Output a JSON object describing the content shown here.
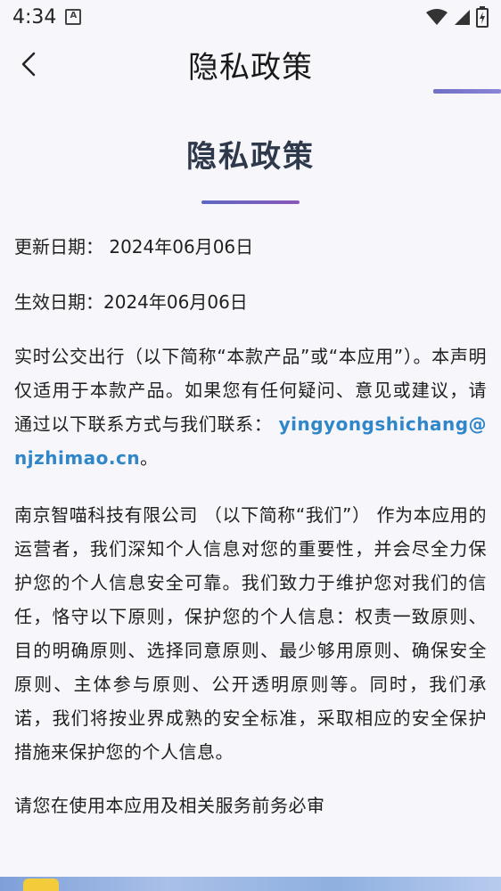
{
  "status_bar": {
    "time": "4:34",
    "notification_letter": "A",
    "icons": [
      "wifi-icon",
      "signal-icon",
      "battery-charging-icon"
    ]
  },
  "app_bar": {
    "title": "隐私政策",
    "back_icon": "chevron-left-icon",
    "accent_color": "#7a7ad0"
  },
  "content": {
    "heading": "隐私政策",
    "updated_label": "更新日期：",
    "updated_date": "2024年06月06日",
    "effective_label": "生效日期：",
    "effective_date": "2024年06月06日",
    "intro_text": "实时公交出行（以下简称“本款产品”或“本应用”）。本声明仅适用于本款产品。如果您有任何疑问、意见或建议，请通过以下联系方式与我们联系：",
    "contact_email": "yingyongshichang@njzhimao.cn",
    "email_suffix": "。",
    "company_text": "南京智喵科技有限公司 （以下简称“我们”） 作为本应用的运营者，我们深知个人信息对您的重要性，并会尽全力保护您的个人信息安全可靠。我们致力于维护您对我们的信任，恪守以下原则，保护您的个人信息：权责一致原则、目的明确原则、选择同意原则、最少够用原则、确保安全原则、主体参与原则、公开透明原则等。同时，我们承诺，我们将按业界成熟的安全标准，采取相应的安全保护措施来保护您的个人信息。",
    "partial_text": "请您在使用本应用及相关服务前务必审"
  },
  "colors": {
    "background": "#f7f6fb",
    "heading": "#2e3a4b",
    "link": "#2f86c8",
    "divider_start": "#5e67c2",
    "divider_end": "#8a58b8"
  }
}
